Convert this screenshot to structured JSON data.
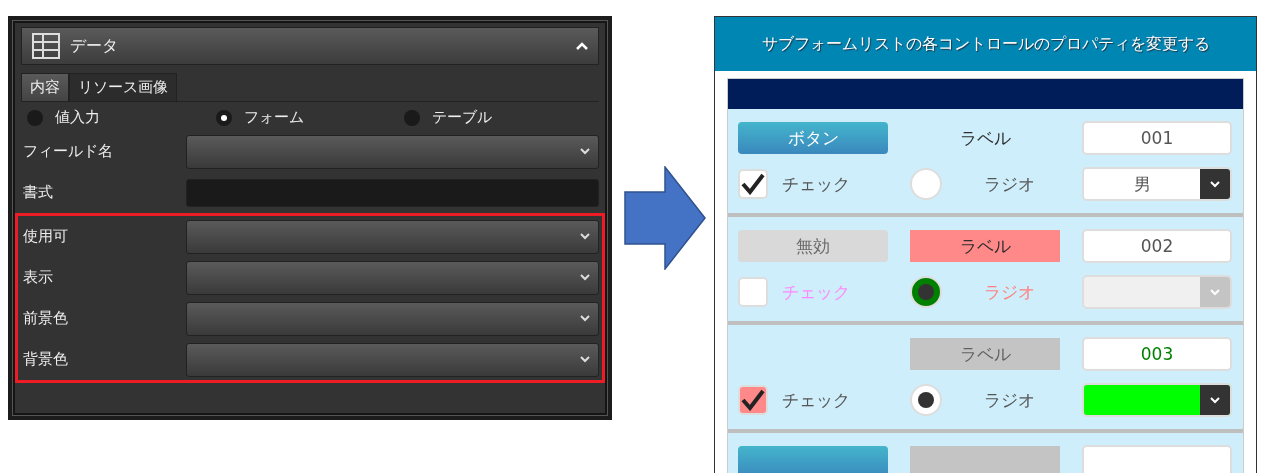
{
  "properties_panel": {
    "title": "データ",
    "expanded": true,
    "tabs": [
      {
        "label": "内容",
        "selected": true
      },
      {
        "label": "リソース画像",
        "selected": false
      }
    ],
    "source_options": [
      {
        "label": "値入力",
        "selected": false
      },
      {
        "label": "フォーム",
        "selected": true
      },
      {
        "label": "テーブル",
        "selected": false
      }
    ],
    "fields": [
      {
        "label": "フィールド名",
        "kind": "dropdown",
        "highlighted": false
      },
      {
        "label": "書式",
        "kind": "text",
        "highlighted": false
      },
      {
        "label": "使用可",
        "kind": "dropdown",
        "highlighted": true
      },
      {
        "label": "表示",
        "kind": "dropdown",
        "highlighted": true
      },
      {
        "label": "前景色",
        "kind": "dropdown",
        "highlighted": true
      },
      {
        "label": "背景色",
        "kind": "dropdown",
        "highlighted": true
      }
    ]
  },
  "preview": {
    "title": "サブフォームリストの各コントロールのプロパティを変更する",
    "records": [
      {
        "button": {
          "text": "ボタン",
          "disabled": false
        },
        "label": {
          "text": "ラベル",
          "disabled": false
        },
        "field": {
          "value": "001"
        },
        "check": {
          "checked": true
        },
        "check_label": {
          "text": "チェック"
        },
        "radio": {
          "selected": false
        },
        "radio_label": {
          "text": "ラジオ"
        },
        "dropdown": {
          "value": "男",
          "disabled": false
        }
      },
      {
        "button": {
          "text": "無効",
          "disabled": true
        },
        "label": {
          "text": "ラベル",
          "disabled": false,
          "color": "#ff8888"
        },
        "field": {
          "value": "002"
        },
        "check": {
          "checked": false
        },
        "check_label": {
          "text": "チェック",
          "color": "#ff88ff"
        },
        "radio": {
          "selected": true,
          "color": "#008000"
        },
        "radio_label": {
          "text": "ラジオ",
          "color": "#ff7f7f"
        },
        "dropdown": {
          "disabled": true
        }
      },
      {
        "label": {
          "text": "ラベル",
          "disabled": true
        },
        "field": {
          "value": "003",
          "color": "#008000"
        },
        "check": {
          "checked": true,
          "color": "#ff8888"
        },
        "check_label": {
          "text": "チェック"
        },
        "radio": {
          "selected": true
        },
        "radio_label": {
          "text": "ラジオ"
        },
        "dropdown": {
          "disabled": false,
          "color": "#00ff00"
        }
      },
      {
        "partial": true
      }
    ]
  }
}
